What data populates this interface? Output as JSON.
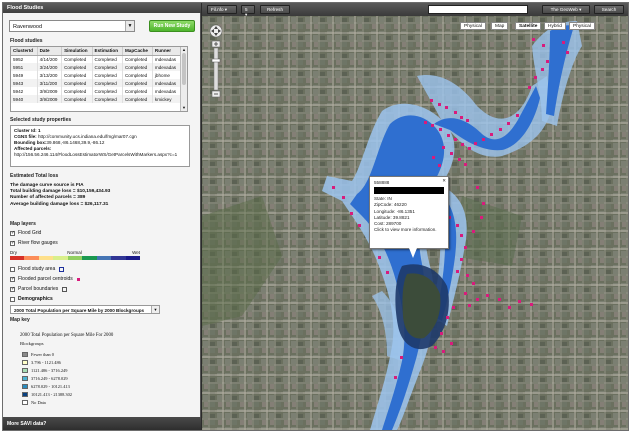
{
  "panel": {
    "title": "Flood Studies",
    "study_select": "Ravenwood",
    "run_button": "Run New Study",
    "studies_heading": "Flood studies",
    "columns": [
      "ClusterId",
      "Date",
      "Simulation",
      "Estimation",
      "MapCache",
      "Runner"
    ],
    "rows": [
      [
        "5952",
        "4/14/200",
        "Completed",
        "Completed",
        "Completed",
        "mdevadas"
      ],
      [
        "5951",
        "3/24/200",
        "Completed",
        "Completed",
        "Completed",
        "mdevadas"
      ],
      [
        "5949",
        "3/13/200",
        "Completed",
        "Completed",
        "Completed",
        "jbhome"
      ],
      [
        "5943",
        "3/11/200",
        "Completed",
        "Completed",
        "Completed",
        "mdevadas"
      ],
      [
        "5942",
        "3/9/2009",
        "Completed",
        "Completed",
        "Completed",
        "mdevadas"
      ],
      [
        "5940",
        "3/9/2009",
        "Completed",
        "Completed",
        "Completed",
        "kmickey"
      ]
    ],
    "props_heading": "Selected study properties",
    "props": {
      "cluster": "Cluster Id: 1",
      "cgns_label": "CGNS file:",
      "cgns_value": "http://community.ucs.indiana.edu/fmg/mar07.cgn",
      "bbox_label": "Bounding box:",
      "bbox_value": "39.868,-86.1468,39.9,-86.12",
      "parcels_label": "Affected parcels:",
      "parcels_value": "http://156.56.246.114/FloodLossEstimatorWS/GetParcelsWithMarkers.aspx?c=1"
    },
    "loss_heading": "Estimated Total loss",
    "loss_lines": [
      "The damage curve source is FIA",
      "Total building damage loss = $10,159,434.93",
      "Number of affected parcels = 389",
      "Average building damage loss = $26,117.31"
    ],
    "layers_heading": "Map layers",
    "layers": {
      "flood_grid": "Flood Grid",
      "river_gauges": "River flow gauges",
      "dry": "Dry",
      "normal": "Normal",
      "wet": "Wet",
      "study_area": "Flood study area",
      "flooded_parcels": "Flooded parcel centroids",
      "parcel_boundaries": "Parcel boundaries",
      "demographics": "Demographics"
    },
    "demo_select": "2000 Total Population per Square Mile by 2000 Blockgroups",
    "mapkey_heading": "Map key",
    "mapkey_title": "2000 Total Population per Square Mile For 2000",
    "mapkey_sub": "Blockgroups",
    "mapkey_items": [
      {
        "label": "Fewer than 0",
        "color": "#8a8a8a"
      },
      {
        "label": "3.796 - 1121.486",
        "color": "#ffffc8"
      },
      {
        "label": "1121.486 - 3716.249",
        "color": "#a8ddb5"
      },
      {
        "label": "3716.249 - 6278.029",
        "color": "#4eb3d3"
      },
      {
        "label": "6278.029 - 10121.413",
        "color": "#2b8cbe"
      },
      {
        "label": "10121.413 - 21388.302",
        "color": "#084081"
      },
      {
        "label": "No Data",
        "color": "#ffffff"
      }
    ],
    "footer": "More SAVI data?"
  },
  "toolbar": {
    "filter_select": "Fil.nfo",
    "zoom_select": "5",
    "refresh": "Refresh",
    "search_scope": "The GeoWeb",
    "search_button": "Search"
  },
  "map": {
    "types": [
      "Physical",
      "Map",
      "Satellite",
      "Hybrid",
      "Physical"
    ],
    "popup": {
      "id": "558888",
      "state": "State: IN",
      "zip": "ZipCode: 46220",
      "lon": "Longitude: -86.1351",
      "lat": "Latitude: 39.8821",
      "cost": "Cost: 289700",
      "more": "Click to view more information."
    }
  },
  "colors": {
    "accent_green": "#4eb52d",
    "parcel_marker": "#d81b7c",
    "flood_water": "#2f6fd0",
    "flood_halo": "#9cc4ee"
  }
}
